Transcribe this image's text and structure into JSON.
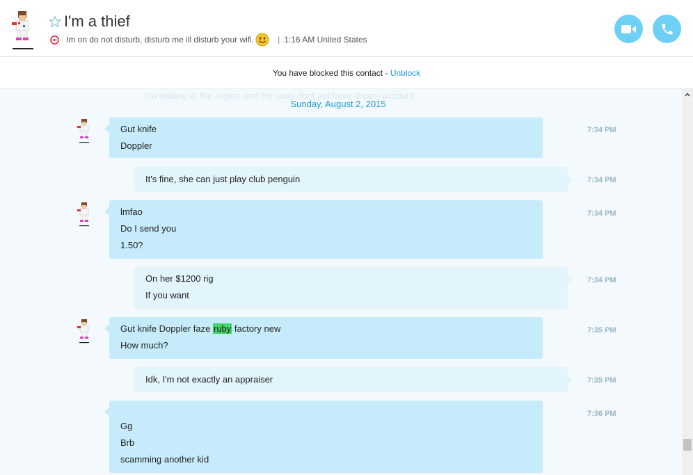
{
  "header": {
    "contact_name": "I'm a thief",
    "mood": "Im on do not disturb, disturb me ill disturb your wifi.",
    "local_time": "1:16 AM United States",
    "icons": {
      "favorite": "star-icon",
      "status": "do-not-disturb-icon",
      "emoji": "smile-emoji-icon",
      "video": "video-camera-icon",
      "call": "phone-icon"
    },
    "accent_color": "#6fd0f5"
  },
  "banner": {
    "text": "You have blocked this contact - ",
    "link": "Unblock"
  },
  "chat": {
    "ghost_line": "I'm waiting at the airport and my story dont yet have dream account..",
    "date": "Sunday, August 2, 2015",
    "messages": [
      {
        "sender": "contact",
        "lines": [
          "Gut knife",
          "Doppler"
        ],
        "time": "7:34 PM"
      },
      {
        "sender": "me",
        "lines": [
          "It's fine, she can just play club penguin"
        ],
        "time": "7:34 PM"
      },
      {
        "sender": "contact",
        "lines": [
          "lmfao",
          "Do I send you",
          "1.50?"
        ],
        "time": "7:34 PM"
      },
      {
        "sender": "me",
        "lines": [
          "On her $1200 rig",
          "If you want"
        ],
        "time": "7:34 PM"
      },
      {
        "sender": "contact",
        "line1_before": "Gut knife Doppler faze ",
        "line1_highlight": "ruby",
        "line1_after": " factory new",
        "line2": "How much?",
        "time": "7:35 PM"
      },
      {
        "sender": "me",
        "lines": [
          "Idk, I'm not exactly an appraiser"
        ],
        "time": "7:35 PM"
      },
      {
        "sender": "contact",
        "lines": [
          "Gg",
          "Brb",
          "scamming another kid"
        ],
        "time": "7:36 PM"
      }
    ]
  },
  "colors": {
    "incoming_bubble": "#c6ebfa",
    "outgoing_bubble": "#e2f4fc",
    "link": "#1a9ad6",
    "highlight": "#46d16a"
  }
}
